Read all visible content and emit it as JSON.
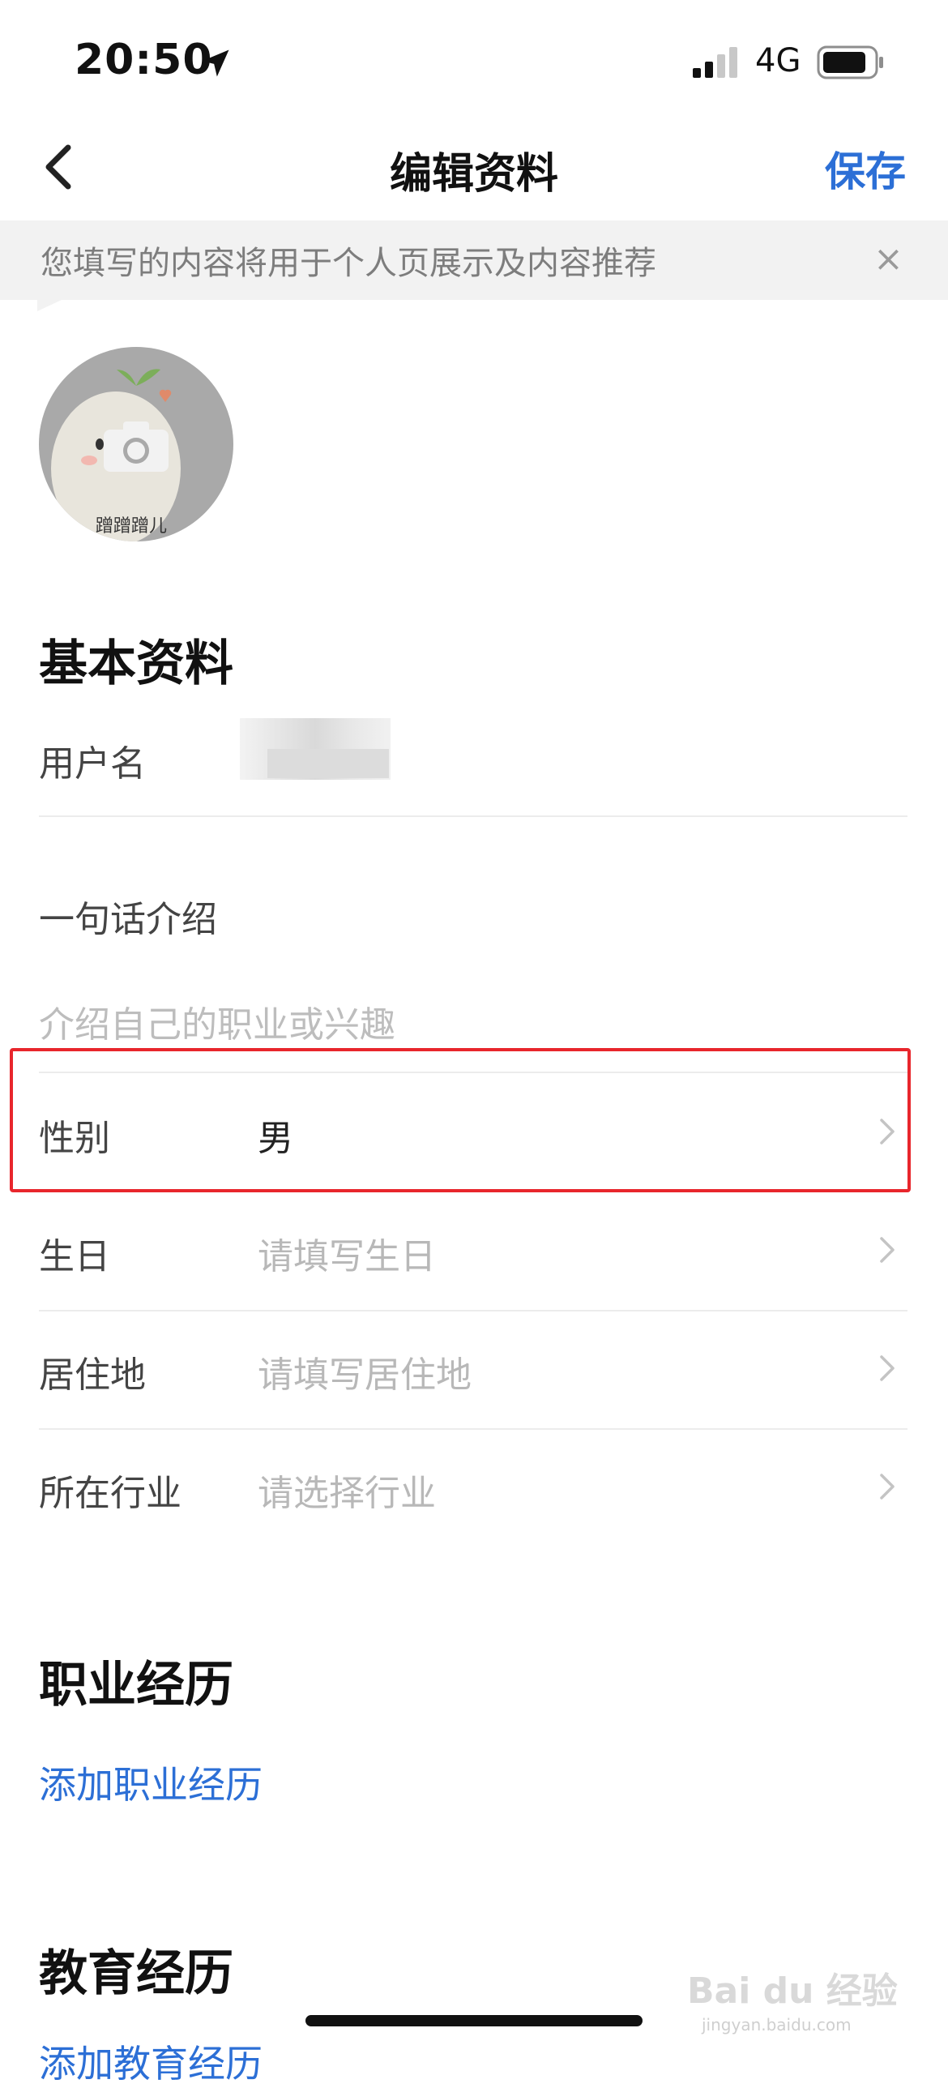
{
  "status_bar": {
    "time": "20:50",
    "network": "4G"
  },
  "nav": {
    "title": "编辑资料",
    "save_label": "保存"
  },
  "tip": {
    "text": "您填写的内容将用于个人页展示及内容推荐",
    "close": "×"
  },
  "avatar": {
    "caption": "蹭蹭蹭儿"
  },
  "basic_section": {
    "title": "基本资料",
    "username_label": "用户名",
    "intro_label": "一句话介绍",
    "intro_placeholder": "介绍自己的职业或兴趣",
    "gender_label": "性别",
    "gender_value": "男",
    "birthday_label": "生日",
    "birthday_placeholder": "请填写生日",
    "residence_label": "居住地",
    "residence_placeholder": "请填写居住地",
    "industry_label": "所在行业",
    "industry_placeholder": "请选择行业"
  },
  "career_section": {
    "title": "职业经历",
    "add_label": "添加职业经历"
  },
  "education_section": {
    "title": "教育经历",
    "add_label": "添加教育经历"
  },
  "watermark": {
    "brand": "Bai du 经验",
    "url": "jingyan.baidu.com"
  },
  "colors": {
    "accent": "#2c6fd6",
    "highlight": "#e8262c"
  }
}
